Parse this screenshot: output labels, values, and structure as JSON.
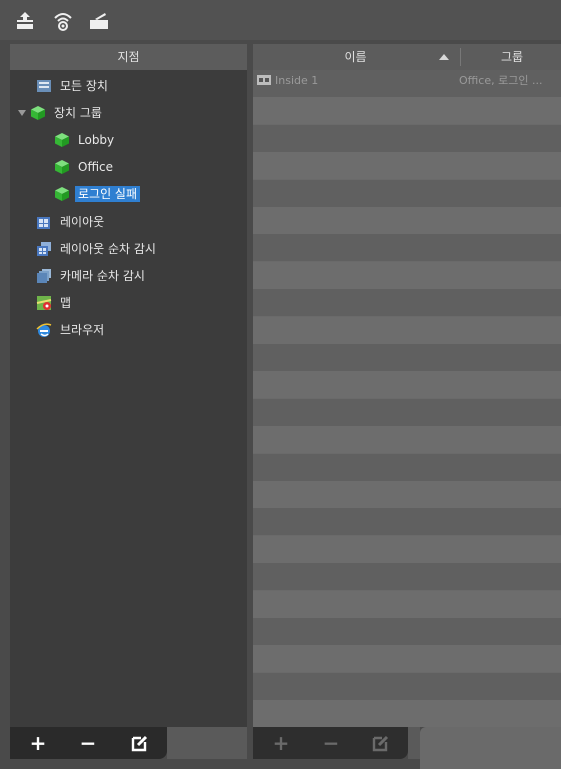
{
  "toolbar": {
    "icons": [
      "upload-icon",
      "wireless-icon",
      "card-reader-icon"
    ]
  },
  "left_panel": {
    "header": "지점",
    "items": [
      {
        "label": "모든 장치",
        "icon": "device-list-icon",
        "indent": 0
      },
      {
        "label": "장치 그룹",
        "icon": "group-cube-icon",
        "indent": 0,
        "expanded": true
      },
      {
        "label": "Lobby",
        "icon": "group-cube-icon",
        "indent": 1
      },
      {
        "label": "Office",
        "icon": "group-cube-icon",
        "indent": 1
      },
      {
        "label": "로그인 실패",
        "icon": "group-cube-icon",
        "indent": 1,
        "selected": true
      },
      {
        "label": "레이아웃",
        "icon": "layout-icon",
        "indent": 0
      },
      {
        "label": "레이아웃 순차 감시",
        "icon": "layout-sequence-icon",
        "indent": 0
      },
      {
        "label": "카메라 순차 감시",
        "icon": "camera-sequence-icon",
        "indent": 0
      },
      {
        "label": "맵",
        "icon": "map-icon",
        "indent": 0
      },
      {
        "label": "브라우저",
        "icon": "browser-icon",
        "indent": 0
      }
    ],
    "footer_buttons": {
      "add": "+",
      "remove": "−",
      "edit": "edit-icon"
    }
  },
  "right_panel": {
    "columns": {
      "name": "이름",
      "group": "그룹"
    },
    "sort": "ascending",
    "rows": [
      {
        "name": "Inside 1",
        "group": "Office, 로그인 ..."
      }
    ],
    "footer_buttons": {
      "add": "+",
      "remove": "−",
      "edit": "edit-icon"
    }
  },
  "colors": {
    "selection": "#2f7fd1",
    "cube_green": "#3ecb3e",
    "panel_bg": "#3c3c3c"
  }
}
